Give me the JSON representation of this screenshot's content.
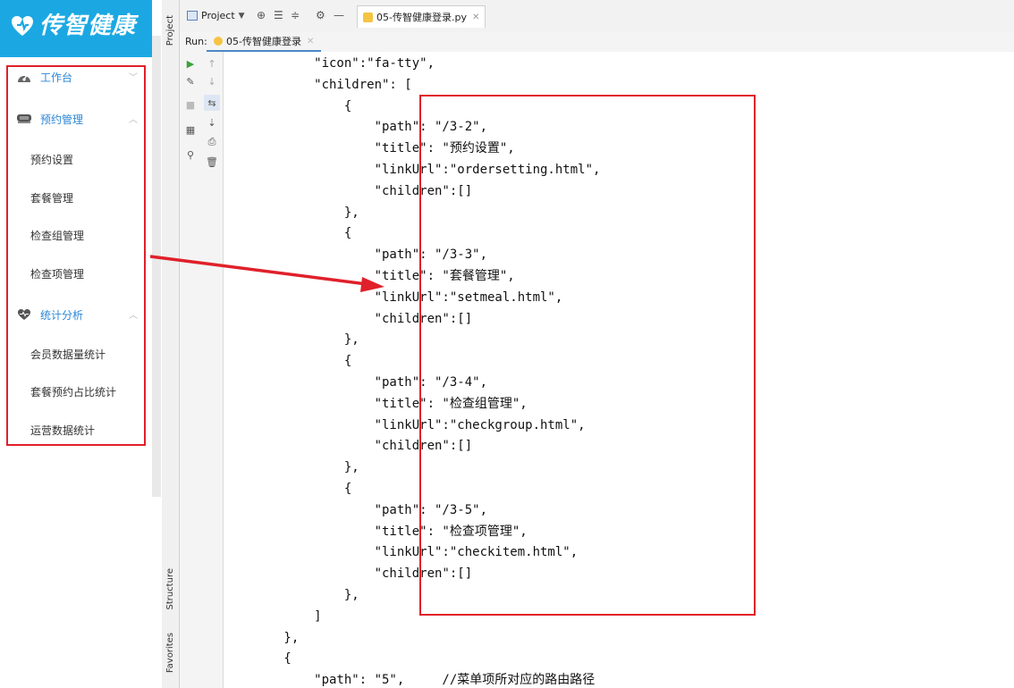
{
  "app": {
    "logo_text": "传智健康",
    "menu": [
      {
        "group": "工作台",
        "icon": "dashboard-icon",
        "expanded": false,
        "items": []
      },
      {
        "group": "预约管理",
        "icon": "calendar-tray-icon",
        "expanded": true,
        "items": [
          "预约设置",
          "套餐管理",
          "检查组管理",
          "检查项管理"
        ]
      },
      {
        "group": "统计分析",
        "icon": "heart-pulse-icon",
        "expanded": true,
        "items": [
          "会员数据量统计",
          "套餐预约占比统计",
          "运营数据统计"
        ]
      }
    ]
  },
  "ide": {
    "project_label": "Project",
    "editor_tab": "05-传智健康登录.py",
    "run_label": "Run:",
    "run_tab": "05-传智健康登录",
    "side_tabs": {
      "project": "Project",
      "structure": "Structure",
      "favorites": "Favorites"
    }
  },
  "code_lines": [
    "            \"icon\":\"fa-tty\",",
    "            \"children\": [",
    "                {",
    "                    \"path\": \"/3-2\",",
    "                    \"title\": \"预约设置\",",
    "                    \"linkUrl\":\"ordersetting.html\",",
    "                    \"children\":[]",
    "                },",
    "                {",
    "                    \"path\": \"/3-3\",",
    "                    \"title\": \"套餐管理\",",
    "                    \"linkUrl\":\"setmeal.html\",",
    "                    \"children\":[]",
    "                },",
    "                {",
    "                    \"path\": \"/3-4\",",
    "                    \"title\": \"检查组管理\",",
    "                    \"linkUrl\":\"checkgroup.html\",",
    "                    \"children\":[]",
    "                },",
    "                {",
    "                    \"path\": \"/3-5\",",
    "                    \"title\": \"检查项管理\",",
    "                    \"linkUrl\":\"checkitem.html\",",
    "                    \"children\":[]",
    "                },",
    "            ]",
    "        },",
    "        {",
    "            \"path\": \"5\",     //菜单项所对应的路由路径"
  ],
  "colors": {
    "accent": "#1ba8e2",
    "menu_group": "#2a86d6",
    "annotation_red": "#e0202a"
  }
}
